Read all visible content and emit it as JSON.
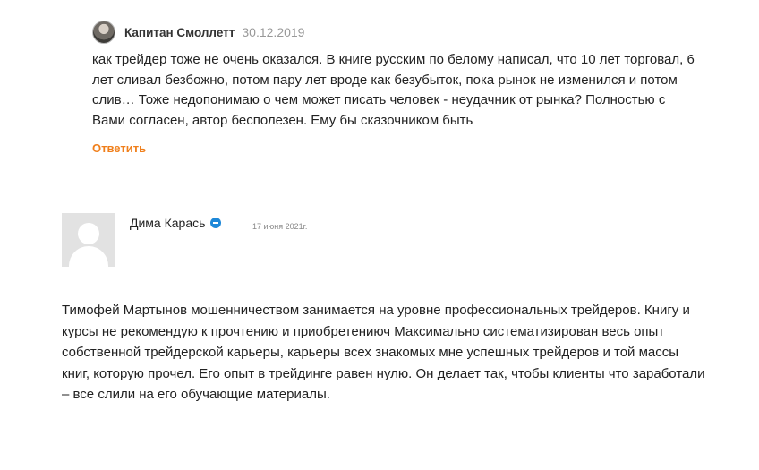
{
  "reply": {
    "author": "Капитан Смоллетт",
    "date": "30.12.2019",
    "text": "как трейдер тоже не очень оказался. В книге русским по белому написал, что 10 лет торговал, 6 лет сливал безбожно, потом пару лет вроде как безубыток, пока рынок не изменился и потом слив… Тоже недопонимаю о чем может писать человек - неудачник от рынка? Полностью с Вами согласен, автор бесполезен. Ему бы сказочником быть",
    "reply_label": "Ответить"
  },
  "comment": {
    "author": "Дима Карась",
    "date": "17 июня 2021г.",
    "text": "Тимофей Мартынов мошенничеством занимается на уровне профессиональных трейдеров. Книгу и курсы не рекомендую к прочтению и приобретениюч Максимально систематизирован весь опыт собственной трейдерской карьеры, карьеры всех знакомых мне успешных трейдеров и той массы книг, которую прочел. Его опыт в трейдинге равен нулю. Он делает так, чтобы клиенты что заработали – все слили на его обучающие материалы."
  }
}
